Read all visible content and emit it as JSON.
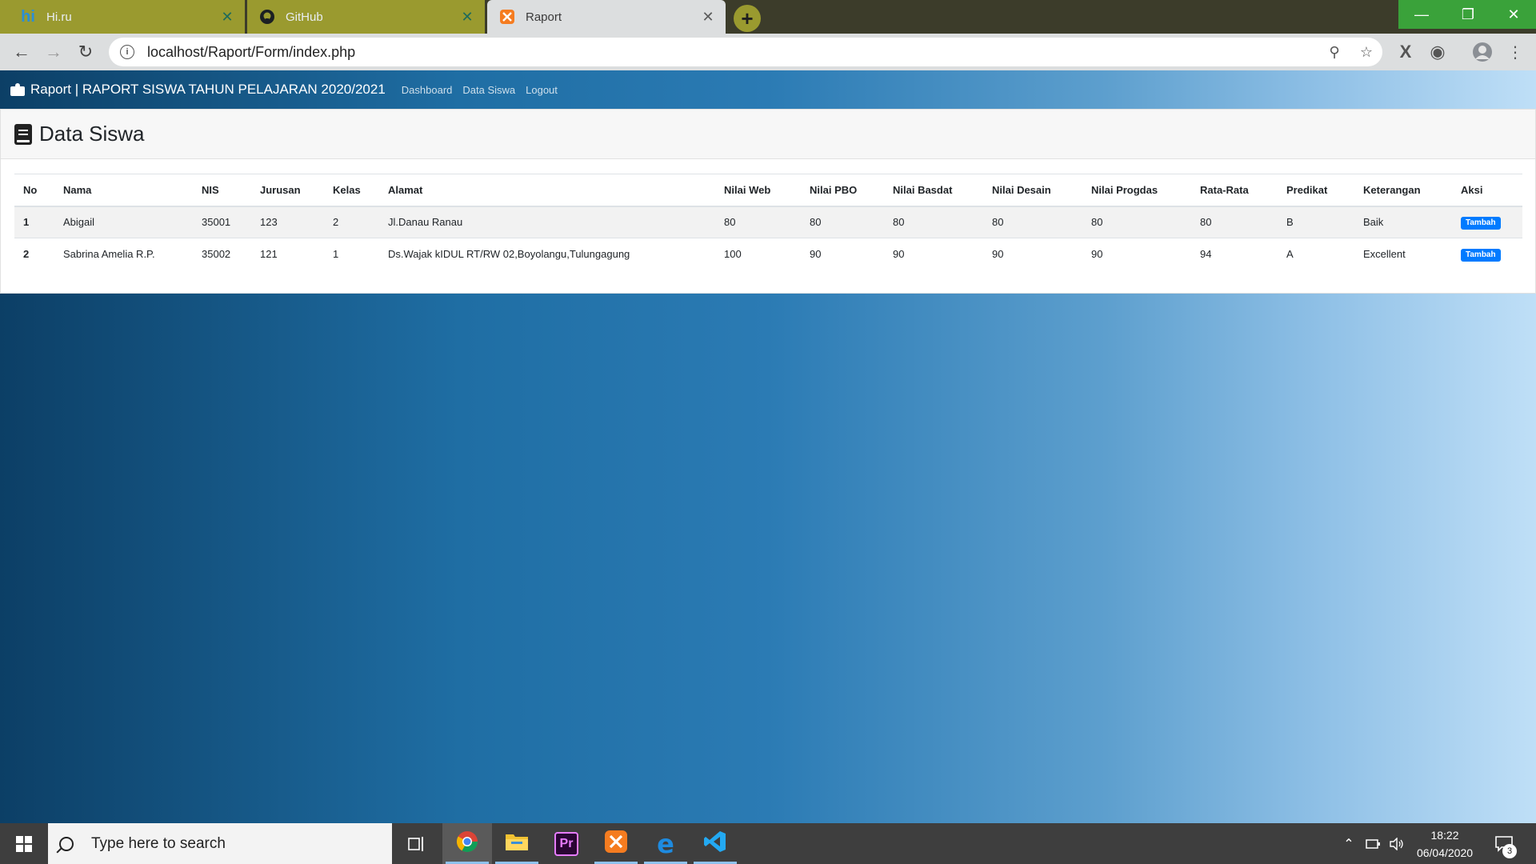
{
  "browser": {
    "tabs": [
      {
        "title": "Hi.ru",
        "icon": "hi-ru-favicon",
        "active": false
      },
      {
        "title": "GitHub",
        "icon": "github-favicon",
        "active": false
      },
      {
        "title": "Raport",
        "icon": "xampp-favicon",
        "active": true
      }
    ],
    "url": "localhost/Raport/Form/index.php"
  },
  "app": {
    "brand": "Raport | RAPORT SISWA TAHUN PELAJARAN 2020/2021",
    "nav": [
      "Dashboard",
      "Data Siswa",
      "Logout"
    ],
    "page_title": "Data Siswa",
    "table": {
      "headers": [
        "No",
        "Nama",
        "NIS",
        "Jurusan",
        "Kelas",
        "Alamat",
        "Nilai Web",
        "Nilai PBO",
        "Nilai Basdat",
        "Nilai Desain",
        "Nilai Progdas",
        "Rata-Rata",
        "Predikat",
        "Keterangan",
        "Aksi"
      ],
      "rows": [
        {
          "no": "1",
          "nama": "Abigail",
          "nis": "35001",
          "jurusan": "123",
          "kelas": "2",
          "alamat": "Jl.Danau Ranau",
          "web": "80",
          "pbo": "80",
          "basdat": "80",
          "desain": "80",
          "progdas": "80",
          "rata": "80",
          "predikat": "B",
          "keterangan": "Baik",
          "aksi": "Tambah"
        },
        {
          "no": "2",
          "nama": "Sabrina Amelia R.P.",
          "nis": "35002",
          "jurusan": "121",
          "kelas": "1",
          "alamat": "Ds.Wajak kIDUL RT/RW 02,Boyolangu,Tulungagung",
          "web": "100",
          "pbo": "90",
          "basdat": "90",
          "desain": "90",
          "progdas": "90",
          "rata": "94",
          "predikat": "A",
          "keterangan": "Excellent",
          "aksi": "Tambah"
        }
      ]
    }
  },
  "taskbar": {
    "search_placeholder": "Type here to search",
    "time": "18:22",
    "date": "06/04/2020",
    "notification_count": "3"
  },
  "colors": {
    "badge": "#007bff",
    "tab_inactive": "#9a9a2f",
    "window_controls": "#3aa23a"
  }
}
